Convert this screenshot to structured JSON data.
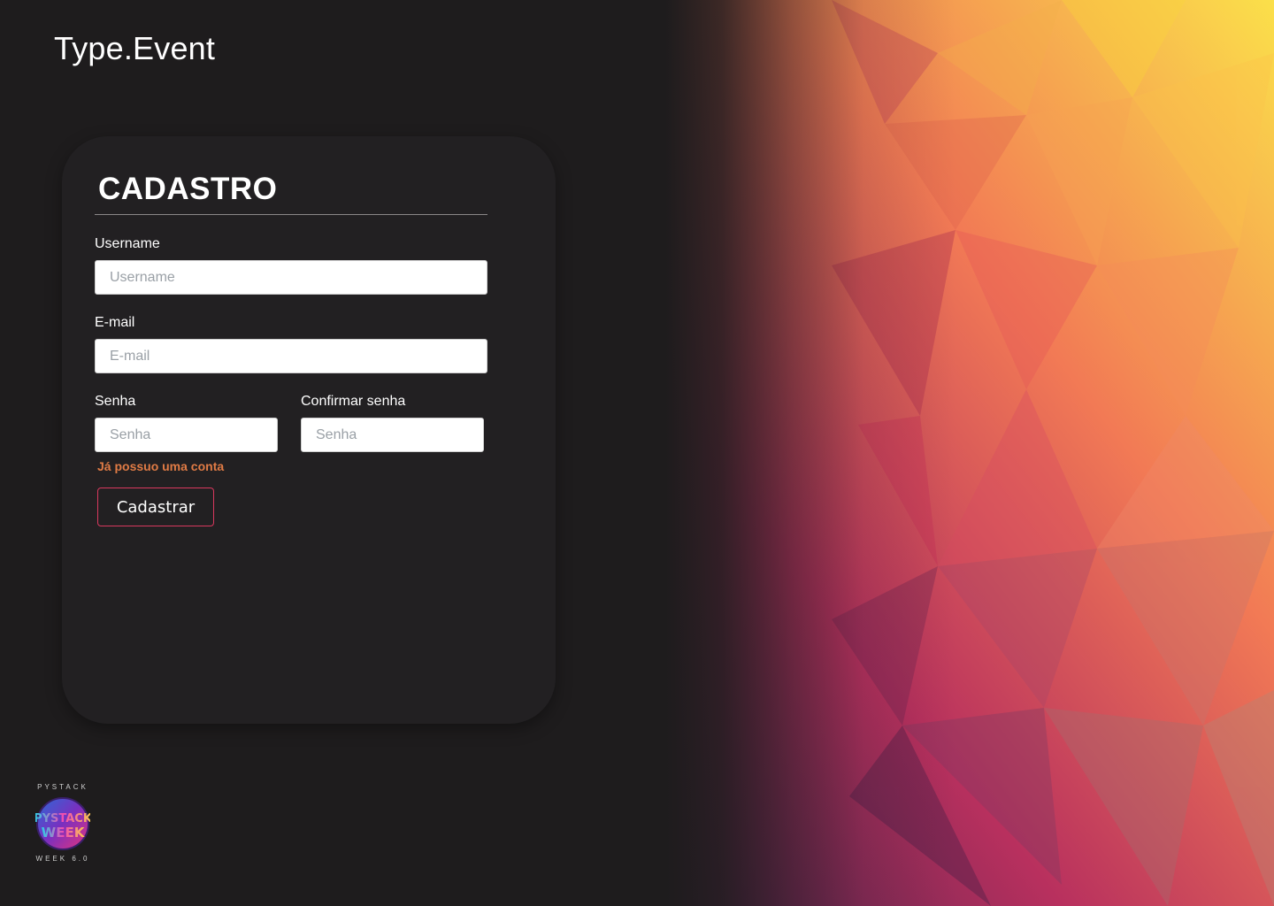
{
  "app": {
    "logo": "Type.Event"
  },
  "form": {
    "title": "CADASTRO",
    "username": {
      "label": "Username",
      "placeholder": "Username",
      "value": ""
    },
    "email": {
      "label": "E-mail",
      "placeholder": "E-mail",
      "value": ""
    },
    "password": {
      "label": "Senha",
      "placeholder": "Senha",
      "value": ""
    },
    "confirm_password": {
      "label": "Confirmar senha",
      "placeholder": "Senha",
      "value": ""
    },
    "login_link": "Já possuo uma conta",
    "submit_label": "Cadastrar"
  },
  "brand": {
    "top_text": "PYSTACK",
    "badge_text": "PYSTACK WEEK",
    "bottom_text": "WEEK 6.0"
  },
  "colors": {
    "background": "#1e1c1d",
    "card": "#222022",
    "accent_link": "#e07b45",
    "button_border": "#d9385e"
  }
}
